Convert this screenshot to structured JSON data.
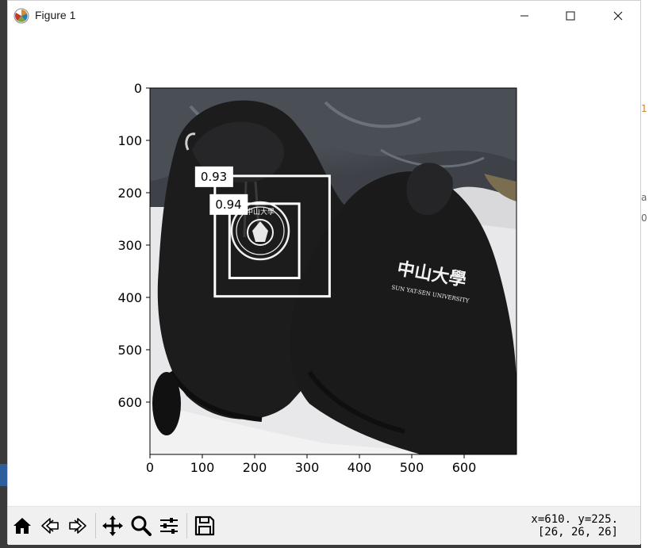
{
  "window": {
    "title": "Figure 1"
  },
  "chart_data": {
    "type": "image",
    "image_description_label": "",
    "xlim": [
      0,
      700
    ],
    "ylim": [
      700,
      0
    ],
    "x_ticks": [
      0,
      100,
      200,
      300,
      400,
      500,
      600
    ],
    "y_ticks": [
      0,
      100,
      200,
      300,
      400,
      500,
      600
    ],
    "x_tick_labels": [
      "0",
      "100",
      "200",
      "300",
      "400",
      "500",
      "600"
    ],
    "y_tick_labels": [
      "0",
      "100",
      "200",
      "300",
      "400",
      "500",
      "600"
    ],
    "detections": [
      {
        "label": "0.93",
        "x1": 124,
        "y1": 168,
        "x2": 343,
        "y2": 398
      },
      {
        "label": "0.94",
        "x1": 152,
        "y1": 221,
        "x2": 285,
        "y2": 363
      }
    ],
    "logo_text": "SUN YAT-SEN UNIVERSITY",
    "logo_cjk": "中山大學"
  },
  "toolbar": {
    "tools": [
      {
        "name": "home-icon"
      },
      {
        "name": "back-arrow-icon"
      },
      {
        "name": "forward-arrow-icon"
      },
      {
        "name": "pan-icon"
      },
      {
        "name": "zoom-icon"
      },
      {
        "name": "configure-subplots-icon"
      },
      {
        "name": "save-icon"
      }
    ]
  },
  "status": {
    "coords": "x=610. y=225.",
    "pixel": "[26, 26, 26]"
  },
  "background": {
    "fragment_1": "1",
    "fragment_2": "a",
    "fragment_3": "0"
  }
}
